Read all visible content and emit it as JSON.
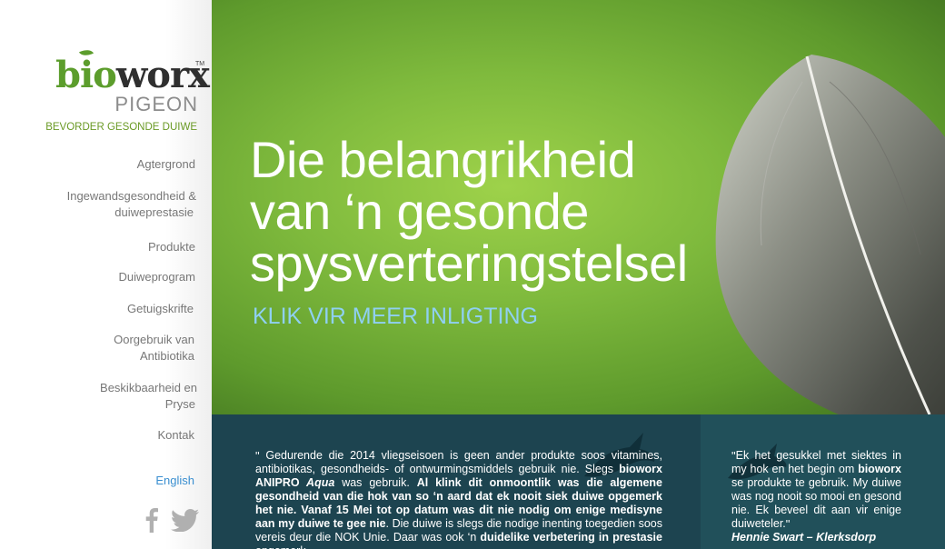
{
  "brand": {
    "logo_part1": "bio",
    "logo_part2": "worx",
    "tm": "TM",
    "sub": "PIGEON",
    "tagline": "BEVORDER GESONDE DUIWE"
  },
  "nav": {
    "items": [
      {
        "line1": "Agtergrond",
        "line2": ""
      },
      {
        "line1": "Ingewandsgesondheid &",
        "line2": "duiweprestasie"
      },
      {
        "line1": "Produkte",
        "line2": ""
      },
      {
        "line1": "Duiweprogram",
        "line2": ""
      },
      {
        "line1": "Getuigskrifte",
        "line2": ""
      },
      {
        "line1": "Oorgebruik van",
        "line2": "Antibiotika"
      },
      {
        "line1": "Beskikbaarheid en",
        "line2": "Pryse"
      },
      {
        "line1": "Kontak",
        "line2": ""
      }
    ],
    "language": "English"
  },
  "social": {
    "facebook_icon": "facebook-icon",
    "twitter_icon": "twitter-icon"
  },
  "hero": {
    "title_line1": "Die belangrikheid",
    "title_line2": "van ‘n gesonde",
    "title_line3": "spysverteringstelsel",
    "cta": "KLIK VIR MEER INLIGTING"
  },
  "testimonial_left": {
    "open_quote": "\"",
    "p1": " Gedurende die 2014 vliegseisoen is geen ander produkte soos vitamines, antibiotikas, gesondheids- of ontwurmingsmiddels gebruik nie. Slegs ",
    "b1": "bioworx ANIPRO",
    "i1": " Aqua",
    "p2": " was gebruik. ",
    "b2": "Al klink dit onmoontlik was die algemene gesondheid van die hok van so ‘n aard dat ek nooit siek duiwe opgemerk het nie. Vanaf 15 Mei tot op datum was dit nie nodig om enige medisyne aan my duiwe te gee nie",
    "p3": ". Die duiwe is slegs die nodige inenting toegedien soos vereis deur die NOK Unie. Daar was ook ‘n ",
    "b3": "duidelike verbetering in prestasie",
    "p4": " opgemerk"
  },
  "testimonial_right": {
    "open_quote": "\"",
    "p1": "Ek het gesukkel met siektes in my hok en het begin om ",
    "b1": "bioworx",
    "p2": " se produkte te gebruik. My duiwe was nog nooit so mooi en gesond nie. Ek beveel dit aan vir enige duiweteler.",
    "close_quote": "\"",
    "author": "Hennie Swart – Klerksdorp"
  }
}
